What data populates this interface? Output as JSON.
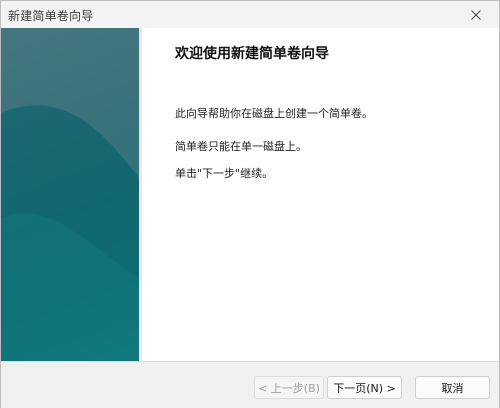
{
  "window": {
    "title": "新建简单卷向导"
  },
  "content": {
    "heading": "欢迎使用新建简单卷向导",
    "paragraph_1": "此向导帮助你在磁盘上创建一个简单卷。",
    "paragraph_2": "简单卷只能在单一磁盘上。",
    "paragraph_3": "单击\"下一步\"继续。"
  },
  "buttons": {
    "back": "< 上一步(B)",
    "next": "下一页(N) >",
    "cancel": "取消"
  },
  "colors": {
    "side_panel_primary": "#17646d",
    "side_panel_accent": "#138b8c"
  },
  "icons": {
    "close": "close-icon"
  }
}
